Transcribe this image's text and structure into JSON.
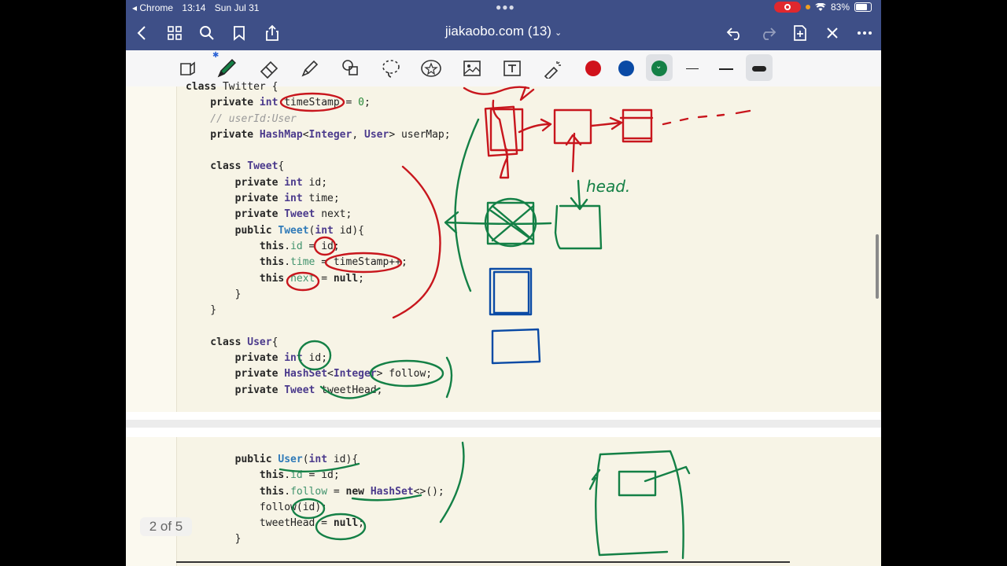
{
  "status_bar": {
    "back_app": "◂ Chrome",
    "time": "13:14",
    "date": "Sun Jul 31",
    "battery": "83%"
  },
  "nav_bar": {
    "title": "jiakaobo.com (13)"
  },
  "toolbar": {
    "ink_colors": [
      "#d0121b",
      "#0a4aa5",
      "#148046"
    ],
    "selected_color": "#148046"
  },
  "page1_code": [
    [
      {
        "t": "class ",
        "c": "kw"
      },
      {
        "t": "Twitter {",
        "c": ""
      }
    ],
    [
      {
        "t": "    private ",
        "c": "kw"
      },
      {
        "t": "int ",
        "c": "ty"
      },
      {
        "t": "timeStamp = ",
        "c": ""
      },
      {
        "t": "0",
        "c": "num"
      },
      {
        "t": ";",
        "c": ""
      }
    ],
    [
      {
        "t": "    // userId:User",
        "c": "cm"
      }
    ],
    [
      {
        "t": "    private ",
        "c": "kw"
      },
      {
        "t": "HashMap",
        "c": "ty"
      },
      {
        "t": "<",
        "c": ""
      },
      {
        "t": "Integer",
        "c": "ty"
      },
      {
        "t": ", ",
        "c": ""
      },
      {
        "t": "User",
        "c": "ty"
      },
      {
        "t": "> userMap;",
        "c": ""
      }
    ],
    [
      {
        "t": "",
        "c": ""
      }
    ],
    [
      {
        "t": "    class ",
        "c": "kw"
      },
      {
        "t": "Tweet",
        "c": "ty"
      },
      {
        "t": "{",
        "c": ""
      }
    ],
    [
      {
        "t": "        private ",
        "c": "kw"
      },
      {
        "t": "int ",
        "c": "ty"
      },
      {
        "t": "id;",
        "c": ""
      }
    ],
    [
      {
        "t": "        private ",
        "c": "kw"
      },
      {
        "t": "int ",
        "c": "ty"
      },
      {
        "t": "time;",
        "c": ""
      }
    ],
    [
      {
        "t": "        private ",
        "c": "kw"
      },
      {
        "t": "Tweet ",
        "c": "ty"
      },
      {
        "t": "next;",
        "c": ""
      }
    ],
    [
      {
        "t": "        public ",
        "c": "kw"
      },
      {
        "t": "Tweet",
        "c": "fn"
      },
      {
        "t": "(",
        "c": ""
      },
      {
        "t": "int ",
        "c": "ty"
      },
      {
        "t": "id){",
        "c": ""
      }
    ],
    [
      {
        "t": "            this",
        "c": "kw"
      },
      {
        "t": ".",
        "c": ""
      },
      {
        "t": "id",
        "c": "fld"
      },
      {
        "t": " = id;",
        "c": ""
      }
    ],
    [
      {
        "t": "            this",
        "c": "kw"
      },
      {
        "t": ".",
        "c": ""
      },
      {
        "t": "time",
        "c": "fld"
      },
      {
        "t": " = timeStamp++;",
        "c": ""
      }
    ],
    [
      {
        "t": "            this",
        "c": "kw"
      },
      {
        "t": ".",
        "c": ""
      },
      {
        "t": "next",
        "c": "fld"
      },
      {
        "t": " = ",
        "c": ""
      },
      {
        "t": "null",
        "c": "kw"
      },
      {
        "t": ";",
        "c": ""
      }
    ],
    [
      {
        "t": "        }",
        "c": ""
      }
    ],
    [
      {
        "t": "    }",
        "c": ""
      }
    ],
    [
      {
        "t": "",
        "c": ""
      }
    ],
    [
      {
        "t": "    class ",
        "c": "kw"
      },
      {
        "t": "User",
        "c": "ty"
      },
      {
        "t": "{",
        "c": ""
      }
    ],
    [
      {
        "t": "        private ",
        "c": "kw"
      },
      {
        "t": "int ",
        "c": "ty"
      },
      {
        "t": "id;",
        "c": ""
      }
    ],
    [
      {
        "t": "        private ",
        "c": "kw"
      },
      {
        "t": "HashSet",
        "c": "ty"
      },
      {
        "t": "<",
        "c": ""
      },
      {
        "t": "Integer",
        "c": "ty"
      },
      {
        "t": "> follow;",
        "c": ""
      }
    ],
    [
      {
        "t": "        private ",
        "c": "kw"
      },
      {
        "t": "Tweet ",
        "c": "ty"
      },
      {
        "t": "tweetHead;",
        "c": ""
      }
    ]
  ],
  "page2_code": [
    [
      {
        "t": "        public ",
        "c": "kw"
      },
      {
        "t": "User",
        "c": "fn"
      },
      {
        "t": "(",
        "c": ""
      },
      {
        "t": "int ",
        "c": "ty"
      },
      {
        "t": "id){",
        "c": ""
      }
    ],
    [
      {
        "t": "            this",
        "c": "kw"
      },
      {
        "t": ".",
        "c": ""
      },
      {
        "t": "id",
        "c": "fld"
      },
      {
        "t": " = id;",
        "c": ""
      }
    ],
    [
      {
        "t": "            this",
        "c": "kw"
      },
      {
        "t": ".",
        "c": ""
      },
      {
        "t": "follow",
        "c": "fld"
      },
      {
        "t": " = ",
        "c": ""
      },
      {
        "t": "new ",
        "c": "kw"
      },
      {
        "t": "HashSet",
        "c": "ty"
      },
      {
        "t": "<>();",
        "c": ""
      }
    ],
    [
      {
        "t": "            follow(id);",
        "c": ""
      }
    ],
    [
      {
        "t": "            tweetHead = ",
        "c": ""
      },
      {
        "t": "null",
        "c": "kw"
      },
      {
        "t": ";",
        "c": ""
      }
    ],
    [
      {
        "t": "        }",
        "c": ""
      }
    ]
  ],
  "handwriting": {
    "head_label": "head."
  },
  "page_indicator": "2 of 5"
}
